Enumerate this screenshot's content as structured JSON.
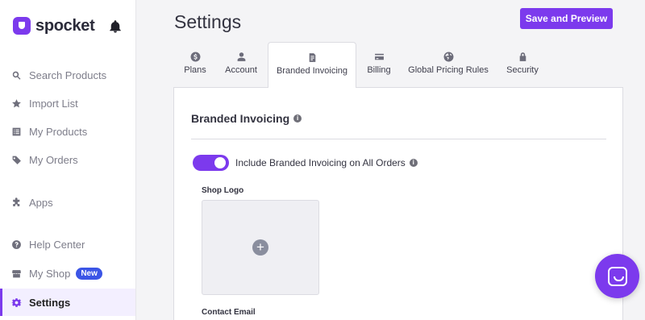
{
  "brand": {
    "name": "spocket"
  },
  "sidebar": {
    "items": [
      {
        "label": "Search Products",
        "icon": "search-icon"
      },
      {
        "label": "Import List",
        "icon": "star-icon"
      },
      {
        "label": "My Products",
        "icon": "list-icon"
      },
      {
        "label": "My Orders",
        "icon": "tag-icon"
      },
      {
        "label": "Apps",
        "icon": "puzzle-icon"
      },
      {
        "label": "Help Center",
        "icon": "question-icon"
      },
      {
        "label": "My Shop",
        "icon": "shop-icon",
        "badge": "New"
      },
      {
        "label": "Settings",
        "icon": "gear-icon",
        "active": true
      }
    ]
  },
  "header": {
    "title": "Settings",
    "save_label": "Save and Preview"
  },
  "tabs": [
    {
      "label": "Plans",
      "icon": "dollar-icon"
    },
    {
      "label": "Account",
      "icon": "user-icon"
    },
    {
      "label": "Branded Invoicing",
      "icon": "invoice-icon",
      "active": true
    },
    {
      "label": "Billing",
      "icon": "card-icon"
    },
    {
      "label": "Global Pricing Rules",
      "icon": "globe-icon"
    },
    {
      "label": "Security",
      "icon": "lock-icon"
    }
  ],
  "panel": {
    "section_title": "Branded Invoicing",
    "toggle_label": "Include Branded Invoicing on All Orders",
    "toggle_on": true,
    "shop_logo_label": "Shop Logo",
    "contact_email_label": "Contact Email",
    "info_glyph": "i",
    "plus_glyph": "+"
  },
  "colors": {
    "accent": "#7c3aed",
    "badge": "#3b55e6",
    "background": "#f4f4f6"
  }
}
